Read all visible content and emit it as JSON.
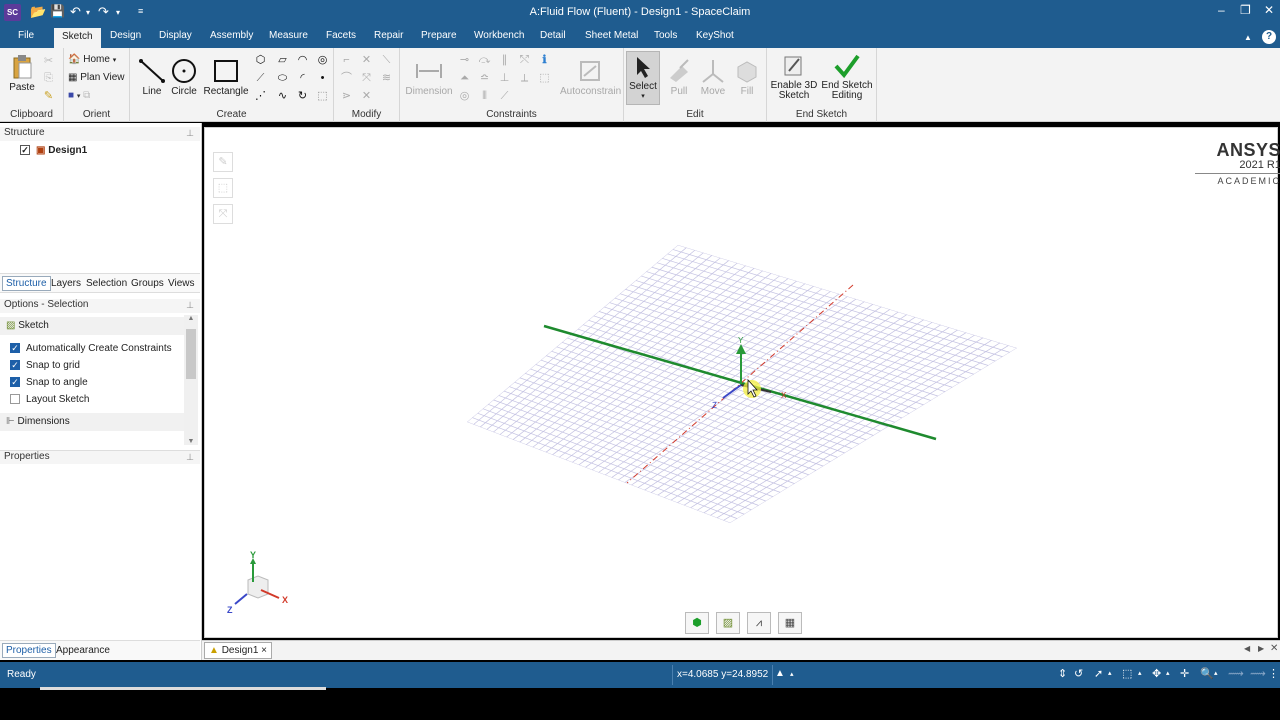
{
  "titlebar": {
    "app_icon": "SC",
    "title": "A:Fluid Flow (Fluent) - Design1 - SpaceClaim",
    "icons": [
      "open-icon",
      "save-icon",
      "undo-icon",
      "redo-icon",
      "customize-icon"
    ],
    "minimize": "–",
    "restore": "❐",
    "close": "✕"
  },
  "menu": {
    "tabs": [
      "File",
      "Sketch",
      "Design",
      "Display",
      "Assembly",
      "Measure",
      "Facets",
      "Repair",
      "Prepare",
      "Workbench",
      "Detail",
      "Sheet Metal",
      "Tools",
      "KeyShot"
    ],
    "active": "Sketch",
    "help": "?",
    "collapse": "▲"
  },
  "ribbon": {
    "clipboard": {
      "label": "Clipboard",
      "paste": "Paste"
    },
    "orient": {
      "label": "Orient",
      "home": "Home",
      "plan_view": "Plan View"
    },
    "create": {
      "label": "Create",
      "line": "Line",
      "circle": "Circle",
      "rectangle": "Rectangle"
    },
    "modify": {
      "label": "Modify"
    },
    "constraints": {
      "label": "Constraints",
      "dimension": "Dimension",
      "autoconstrain": "Autoconstrain"
    },
    "edit": {
      "label": "Edit",
      "select": "Select",
      "pull": "Pull",
      "move": "Move",
      "fill": "Fill"
    },
    "end_sketch": {
      "label": "End Sketch",
      "enable_3d": "Enable 3D Sketch",
      "end_editing": "End Sketch Editing"
    }
  },
  "structure": {
    "header": "Structure",
    "tree_item": "Design1",
    "tabs": [
      "Structure",
      "Layers",
      "Selection",
      "Groups",
      "Views"
    ],
    "active_tab": "Structure"
  },
  "options": {
    "header": "Options - Selection",
    "section": "Sketch",
    "items": [
      {
        "label": "Automatically Create Constraints",
        "checked": true
      },
      {
        "label": "Snap to grid",
        "checked": true
      },
      {
        "label": "Snap to angle",
        "checked": true
      },
      {
        "label": "Layout Sketch",
        "checked": false
      }
    ],
    "dimensions": "Dimensions"
  },
  "properties": {
    "header": "Properties",
    "tabs": [
      "Properties",
      "Appearance"
    ],
    "active_tab": "Properties"
  },
  "viewport": {
    "brand": "ANSYS",
    "version": "2021 R1",
    "edition": "ACADEMIC",
    "axis_x": "X",
    "axis_y": "Y",
    "axis_z": "Z"
  },
  "doc_tab": {
    "label": "Design1",
    "close": "×"
  },
  "status": {
    "text": "Ready",
    "coords": "x=4.0685  y=24.8952"
  },
  "colors": {
    "titlebar": "#1f5c8f",
    "sketch_line": "#1e8a2e",
    "grid": "#b8b6dc",
    "axis_dash": "#d23a2a"
  }
}
